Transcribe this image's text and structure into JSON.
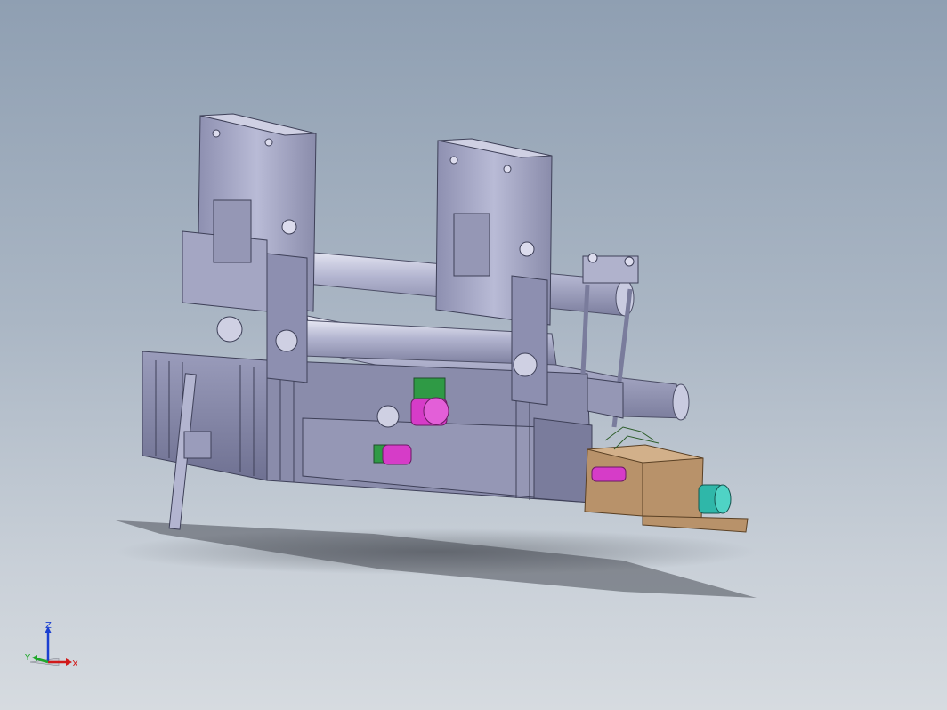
{
  "viewport": {
    "background_top": "#8f9fb2",
    "background_bottom": "#d6dbe0"
  },
  "model": {
    "frame_color": "#a5a7c4",
    "frame_dark": "#6e7090",
    "accent_magenta": "#d63cc8",
    "accent_green": "#2f9a45",
    "accent_teal": "#2fb7a9",
    "base_wood": "#b8926a"
  },
  "triad": {
    "z_label": "Z",
    "x_label": "X",
    "y_label": "Y",
    "z_color": "#1a3fd1",
    "x_color": "#d11a1a",
    "y_color": "#1fa82a"
  }
}
